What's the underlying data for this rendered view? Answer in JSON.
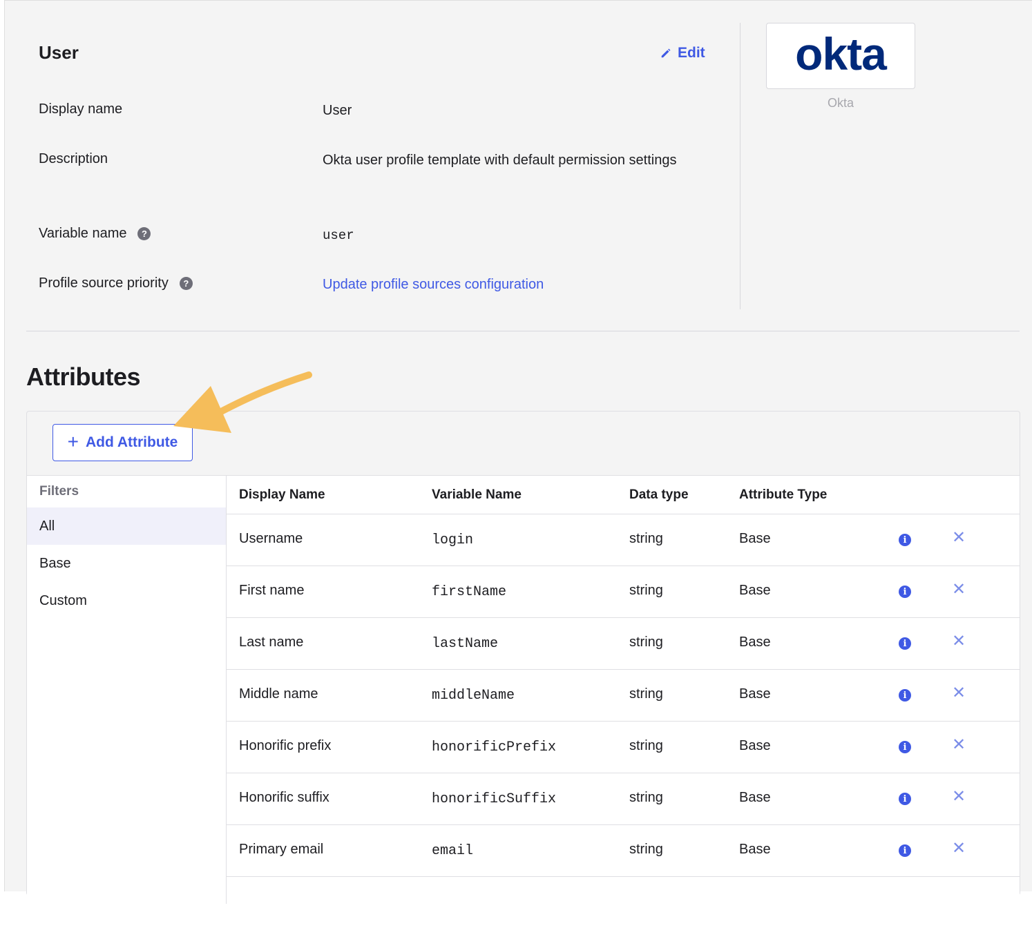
{
  "profile": {
    "title": "User",
    "edit_label": "Edit",
    "rows": [
      {
        "label": "Display name",
        "value": "User"
      },
      {
        "label": "Description",
        "value": "Okta user profile template with default permission settings"
      },
      {
        "label": "Variable name",
        "value": "user"
      },
      {
        "label": "Profile source priority",
        "value": "Update profile sources configuration"
      }
    ],
    "logo_text": "okta",
    "logo_caption": "Okta"
  },
  "attributes": {
    "heading": "Attributes",
    "add_button_label": "Add Attribute",
    "filters": {
      "label": "Filters",
      "items": [
        "All",
        "Base",
        "Custom"
      ],
      "active": "All"
    },
    "columns": [
      "Display Name",
      "Variable Name",
      "Data type",
      "Attribute Type"
    ],
    "rows": [
      {
        "display_name": "Username",
        "variable_name": "login",
        "data_type": "string",
        "attribute_type": "Base"
      },
      {
        "display_name": "First name",
        "variable_name": "firstName",
        "data_type": "string",
        "attribute_type": "Base"
      },
      {
        "display_name": "Last name",
        "variable_name": "lastName",
        "data_type": "string",
        "attribute_type": "Base"
      },
      {
        "display_name": "Middle name",
        "variable_name": "middleName",
        "data_type": "string",
        "attribute_type": "Base"
      },
      {
        "display_name": "Honorific prefix",
        "variable_name": "honorificPrefix",
        "data_type": "string",
        "attribute_type": "Base"
      },
      {
        "display_name": "Honorific suffix",
        "variable_name": "honorificSuffix",
        "data_type": "string",
        "attribute_type": "Base"
      },
      {
        "display_name": "Primary email",
        "variable_name": "email",
        "data_type": "string",
        "attribute_type": "Base"
      }
    ]
  },
  "colors": {
    "accent": "#3f59e4",
    "brand": "#00297a",
    "annotation_arrow": "#f5bd5a"
  }
}
